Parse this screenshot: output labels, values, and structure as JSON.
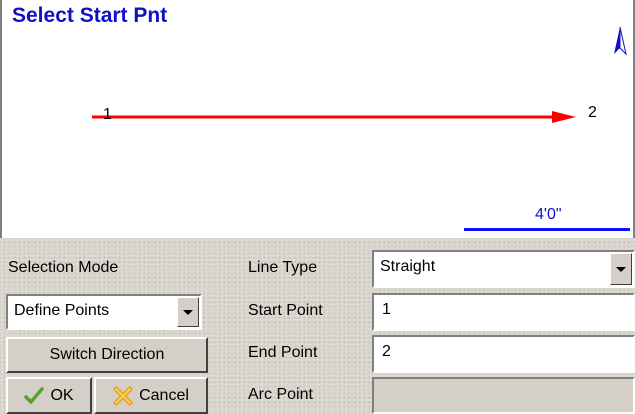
{
  "canvas": {
    "title": "Select Start Pnt",
    "start_point_label": "1",
    "end_point_label": "2",
    "scale_label": "4'0\"",
    "line_color": "#ff0000",
    "north_icon": "north-arrow-icon"
  },
  "panel": {
    "selection_mode_label": "Selection Mode",
    "selection_mode_value": "Define Points",
    "switch_direction_label": "Switch Direction",
    "ok_label": "OK",
    "ok_icon": "checkmark-icon",
    "cancel_label": "Cancel",
    "cancel_icon": "cross-icon",
    "line_type_label": "Line Type",
    "line_type_value": "Straight",
    "start_point_label": "Start Point",
    "start_point_value": "1",
    "end_point_label": "End Point",
    "end_point_value": "2",
    "arc_point_label": "Arc Point",
    "arc_point_value": ""
  }
}
